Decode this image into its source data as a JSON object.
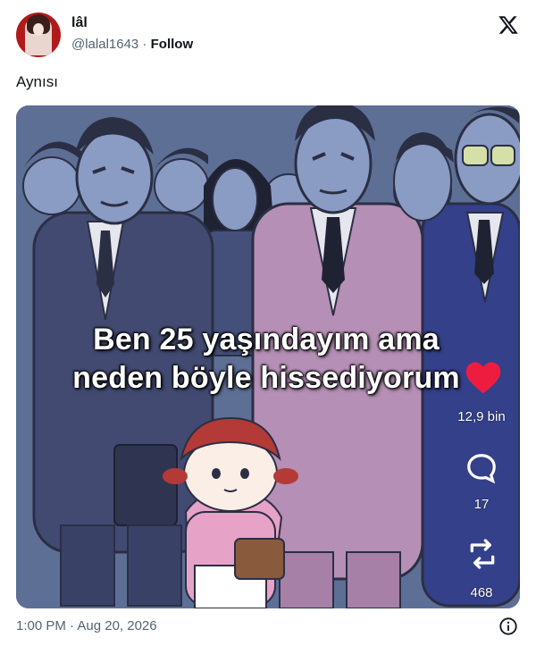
{
  "author": {
    "display_name": "lâl",
    "handle": "@lalal1643",
    "separator": " · ",
    "follow_label": "Follow"
  },
  "tweet": {
    "text": "Aynısı",
    "timestamp": "1:00 PM · Aug 20, 2026"
  },
  "media": {
    "caption_line1": "Ben 25 yaşındayım ama",
    "caption_line2": "neden böyle hissediyorum",
    "like_count": "12,9 bin",
    "reply_count": "17",
    "repost_count": "468",
    "heart_color": "#ee1d3f",
    "background_color": "#5d6f97"
  },
  "icons": {
    "platform_logo": "x-logo-icon",
    "info": "info-icon"
  }
}
